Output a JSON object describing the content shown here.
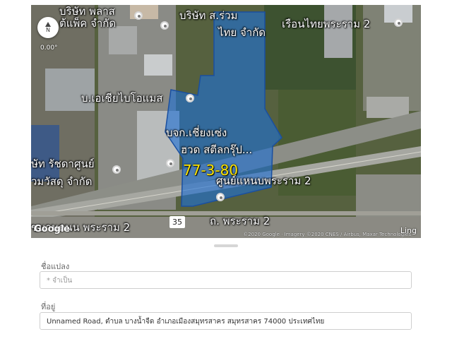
{
  "map": {
    "compass_label": "N",
    "heading": "0.00°",
    "google": "Google",
    "attribution": "©2020 Google · Imagery ©2020 CNES / Airbus, Maxar Technologies",
    "watermark": "Ling",
    "road_shield": "35",
    "parcel_area": "77-3-80",
    "places": [
      {
        "label": "บริษัท พลาส"
      },
      {
        "label": "ต้แพ็ค จำกัด"
      },
      {
        "label": "บริษัท ส.ร่วม"
      },
      {
        "label": "ไทย จำกัด"
      },
      {
        "label": "เรือนไทยพระราม 2"
      },
      {
        "label": "บ.เอเชียไบโอแมส"
      },
      {
        "label": "บจก.เชี่ยงเซ่ง"
      },
      {
        "label": "ฮวด สตีลกรุ๊ป..."
      },
      {
        "label": "ษัท รัชดาศูนย์"
      },
      {
        "label": "วมวัสดุ จำกัด"
      },
      {
        "label": "ศูนย์แหนบพระราม 2"
      },
      {
        "label": "ขนานถนน พระราม 2"
      },
      {
        "label": "ถ. พระราม 2"
      }
    ]
  },
  "form": {
    "parcel_name": {
      "label": "ชื่อแปลง",
      "placeholder": "* จำเป็น",
      "value": ""
    },
    "address": {
      "label": "ที่อยู่",
      "value": "Unnamed Road, ตำบล บางน้ำจืด อำเภอเมืองสมุทรสาคร สมุทรสาคร 74000 ประเทศไทย"
    }
  }
}
